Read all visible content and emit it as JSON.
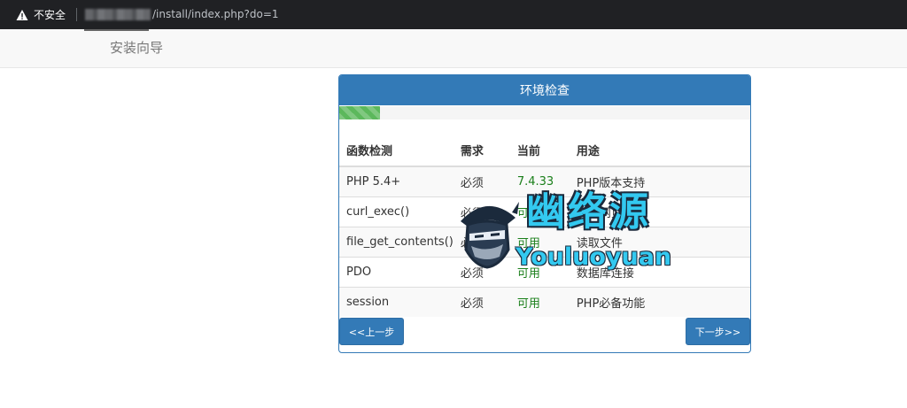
{
  "browser": {
    "security_label": "不安全",
    "url_path": "/install/index.php?do=1"
  },
  "nav": {
    "brand": "安装向导"
  },
  "panel": {
    "title": "环境检查",
    "progress_fraction": 0.1,
    "headers": [
      "函数检测",
      "需求",
      "当前",
      "用途"
    ],
    "rows": [
      {
        "name": "PHP 5.4+",
        "req": "必须",
        "current": "7.4.33",
        "usage": "PHP版本支持"
      },
      {
        "name": "curl_exec()",
        "req": "必须",
        "current": "可用",
        "usage": "抓取网页"
      },
      {
        "name": "file_get_contents()",
        "req": "必须",
        "current": "可用",
        "usage": "读取文件"
      },
      {
        "name": "PDO",
        "req": "必须",
        "current": "可用",
        "usage": "数据库连接"
      },
      {
        "name": "session",
        "req": "必须",
        "current": "可用",
        "usage": "PHP必备功能"
      }
    ],
    "prev_label": "<<上一步",
    "next_label": "下一步>>"
  },
  "watermark": {
    "cn": "幽络源",
    "en": "Youluoyuan"
  },
  "colors": {
    "primary": "#337ab7",
    "success": "#5cb85c",
    "ok_text": "#1a7f1a",
    "watermark": "#33c9f0"
  },
  "icons": {
    "security": "warning-triangle-icon"
  }
}
